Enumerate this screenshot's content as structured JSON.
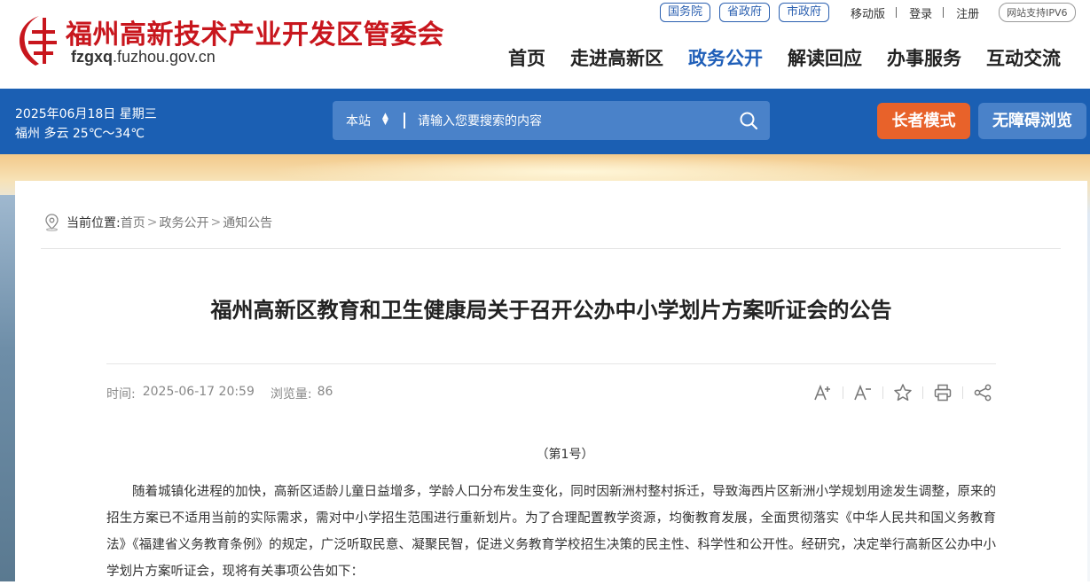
{
  "header": {
    "site_title": "福州高新技术产业开发区管委会",
    "domain_prefix": "fzgxq",
    "domain_rest": ".fuzhou.gov.cn",
    "top_pills": [
      "国务院",
      "省政府",
      "市政府"
    ],
    "mobile": "移动版",
    "login": "登录",
    "register": "注册",
    "ipv6": "网站支持IPV6",
    "nav": [
      "首页",
      "走进高新区",
      "政务公开",
      "解读回应",
      "办事服务",
      "互动交流"
    ],
    "active_nav": "政务公开"
  },
  "bar": {
    "date": "2025年06月18日 星期三",
    "weather": "福州 多云 25℃～34℃",
    "search_scope": "本站",
    "search_placeholder": "请输入您要搜索的内容",
    "elder_mode": "长者模式",
    "accessibility": "无障碍浏览"
  },
  "breadcrumb": {
    "label": "当前位置:",
    "items": [
      "首页",
      "政务公开",
      "通知公告"
    ]
  },
  "article": {
    "title": "福州高新区教育和卫生健康局关于召开公办中小学划片方案听证会的公告",
    "time_label": "时间:",
    "time": "2025-06-17 20:59",
    "views_label": "浏览量:",
    "views": "86",
    "doc_no": "（第1号）",
    "paragraph": "随着城镇化进程的加快，高新区适龄儿童日益增多，学龄人口分布发生变化，同时因新洲村整村拆迁，导致海西片区新洲小学规划用途发生调整，原来的招生方案已不适用当前的实际需求，需对中小学招生范围进行重新划片。为了合理配置教学资源，均衡教育发展，全面贯彻落实《中华人民共和国义务教育法》《福建省义务教育条例》的规定，广泛听取民意、凝聚民智，促进义务教育学校招生决策的民主性、科学性和公开性。经研究，决定举行高新区公办中小学划片方案听证会，现将有关事项公告如下："
  },
  "colors": {
    "brand_red": "#c8161d",
    "nav_blue": "#1b5fb3",
    "elder_orange": "#e8622a"
  }
}
